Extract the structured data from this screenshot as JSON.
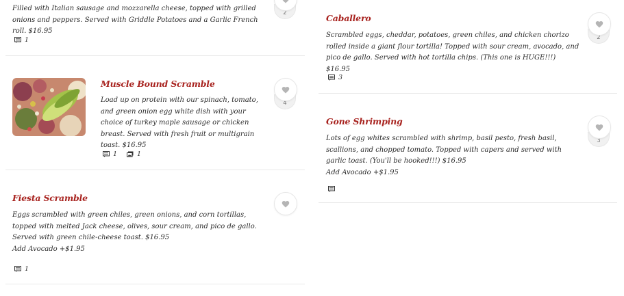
{
  "left": {
    "top_item": {
      "description": "Filled with Italian sausage and mozzarella cheese, topped with grilled onions and peppers. Served with Griddle Potatoes and a Garlic French roll. $16.95",
      "likes": "2",
      "comments": "1"
    },
    "muscle": {
      "title": "Muscle Bound Scramble",
      "description": "Load up on protein with our spinach, tomato, and green onion egg white dish with your choice of turkey maple sausage or chicken breast. Served with fresh fruit or multigrain toast. $16.95",
      "likes": "4",
      "comments": "1",
      "photos": "1"
    },
    "fiesta": {
      "title": "Fiesta Scramble",
      "description": "Eggs scrambled with green chiles, green onions, and corn tortillas, topped with melted Jack cheese, olives, sour cream, and pico de gallo. Served with green chile-cheese toast. $16.95",
      "addon": "Add Avocado +$1.95",
      "comments": "1"
    }
  },
  "right": {
    "caballero": {
      "title": "Caballero",
      "description": "Scrambled eggs, cheddar, potatoes, green chiles, and chicken chorizo rolled inside a giant flour tortilla! Topped with sour cream, avocado, and pico de gallo. Served with hot tortilla chips. (This one is HUGE!!!) $16.95",
      "likes": "2",
      "comments": "3"
    },
    "shrimping": {
      "title": "Gone Shrimping",
      "description": "Lots of egg whites scrambled with shrimp, basil pesto, fresh basil, scallions, and chopped tomato. Topped with capers and served with garlic toast. (You'll be hooked!!!) $16.95",
      "addon": "Add Avocado +$1.95",
      "likes": "3"
    }
  },
  "icons": {
    "heart": "heart-icon",
    "comment": "comment-icon",
    "photo": "photo-icon"
  },
  "colors": {
    "title": "#a8231f",
    "text": "#2b2b2b",
    "divider": "#e8e8e8"
  }
}
